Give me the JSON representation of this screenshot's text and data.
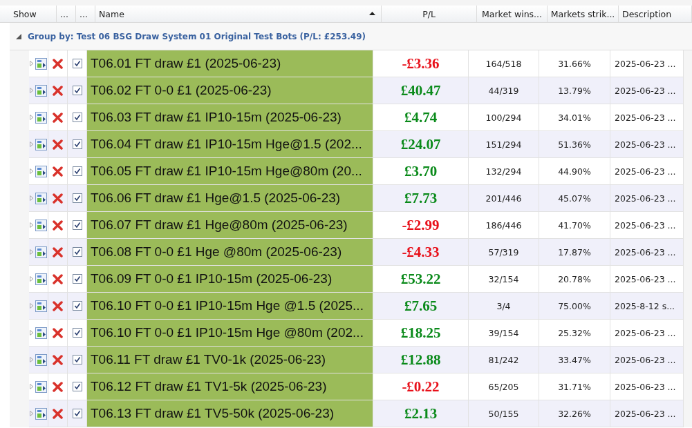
{
  "table": {
    "columns": [
      {
        "label": "Show",
        "sorted": false
      },
      {
        "label": "...",
        "sorted": false
      },
      {
        "label": "...",
        "sorted": false
      },
      {
        "label": "Name",
        "sorted": true
      },
      {
        "label": "P/L",
        "sorted": false
      },
      {
        "label": "Market wins...",
        "sorted": false
      },
      {
        "label": "Markets strik...",
        "sorted": false
      },
      {
        "label": "Description",
        "sorted": false
      }
    ],
    "group": {
      "label": "Group by: Test 06 BSG Draw System 01 Original Test Bots (P/L: £253.49)",
      "expanded": true
    },
    "rows": [
      {
        "name": "T06.01 FT draw £1 (2025-06-23)",
        "pl": "-£3.36",
        "color": "#e8101a",
        "wins": "164/518",
        "strike": "31.66%",
        "description": "2025-06-23 ...",
        "checked": true
      },
      {
        "name": "T06.02 FT 0-0 £1 (2025-06-23)",
        "pl": "£40.47",
        "color": "#0a8a1a",
        "wins": "44/319",
        "strike": "13.79%",
        "description": "2025-06-23 ...",
        "checked": true
      },
      {
        "name": "T06.03 FT draw £1 IP10-15m (2025-06-23)",
        "pl": "£4.74",
        "color": "#0a8a1a",
        "wins": "100/294",
        "strike": "34.01%",
        "description": "2025-06-23 ...",
        "checked": true
      },
      {
        "name": "T06.04 FT draw £1 IP10-15m Hge@1.5 (202...",
        "pl": "£24.07",
        "color": "#0a8a1a",
        "wins": "151/294",
        "strike": "51.36%",
        "description": "2025-06-23 ...",
        "checked": true
      },
      {
        "name": "T06.05 FT draw £1 IP10-15m Hge@80m (20...",
        "pl": "£3.70",
        "color": "#0a8a1a",
        "wins": "132/294",
        "strike": "44.90%",
        "description": "2025-06-23 ...",
        "checked": true
      },
      {
        "name": "T06.06 FT draw £1 Hge@1.5 (2025-06-23)",
        "pl": "£7.73",
        "color": "#0a8a1a",
        "wins": "201/446",
        "strike": "45.07%",
        "description": "2025-06-23 ...",
        "checked": true
      },
      {
        "name": "T06.07 FT draw £1 Hge@80m (2025-06-23)",
        "pl": "-£2.99",
        "color": "#e8101a",
        "wins": "186/446",
        "strike": "41.70%",
        "description": "2025-06-23 ...",
        "checked": true
      },
      {
        "name": "T06.08 FT 0-0 £1 Hge @80m (2025-06-23)",
        "pl": "-£4.33",
        "color": "#e8101a",
        "wins": "57/319",
        "strike": "17.87%",
        "description": "2025-06-23 ...",
        "checked": true
      },
      {
        "name": "T06.09 FT 0-0 £1 IP10-15m (2025-06-23)",
        "pl": "£53.22",
        "color": "#0a8a1a",
        "wins": "32/154",
        "strike": "20.78%",
        "description": "2025-06-23 ...",
        "checked": true
      },
      {
        "name": "T06.10 FT 0-0 £1 IP10-15m Hge @1.5 (2025...",
        "pl": "£7.65",
        "color": "#0a8a1a",
        "wins": "3/4",
        "strike": "75.00%",
        "description": "2025-8-12 s...",
        "checked": true
      },
      {
        "name": "T06.10 FT 0-0 £1 IP10-15m Hge @80m (202...",
        "pl": "£18.25",
        "color": "#0a8a1a",
        "wins": "39/154",
        "strike": "25.32%",
        "description": "2025-06-23 ...",
        "checked": true
      },
      {
        "name": "T06.11 FT draw £1 TV0-1k (2025-06-23)",
        "pl": "£12.88",
        "color": "#0a8a1a",
        "wins": "81/242",
        "strike": "33.47%",
        "description": "2025-06-23 ...",
        "checked": true
      },
      {
        "name": "T06.12 FT draw £1 TV1-5k (2025-06-23)",
        "pl": "-£0.22",
        "color": "#e8101a",
        "wins": "65/205",
        "strike": "31.71%",
        "description": "2025-06-23 ...",
        "checked": true
      },
      {
        "name": "T06.13 FT draw £1 TV5-50k (2025-06-23)",
        "pl": "£2.13",
        "color": "#0a8a1a",
        "wins": "50/155",
        "strike": "32.26%",
        "description": "2025-06-23 ...",
        "checked": true
      }
    ]
  }
}
